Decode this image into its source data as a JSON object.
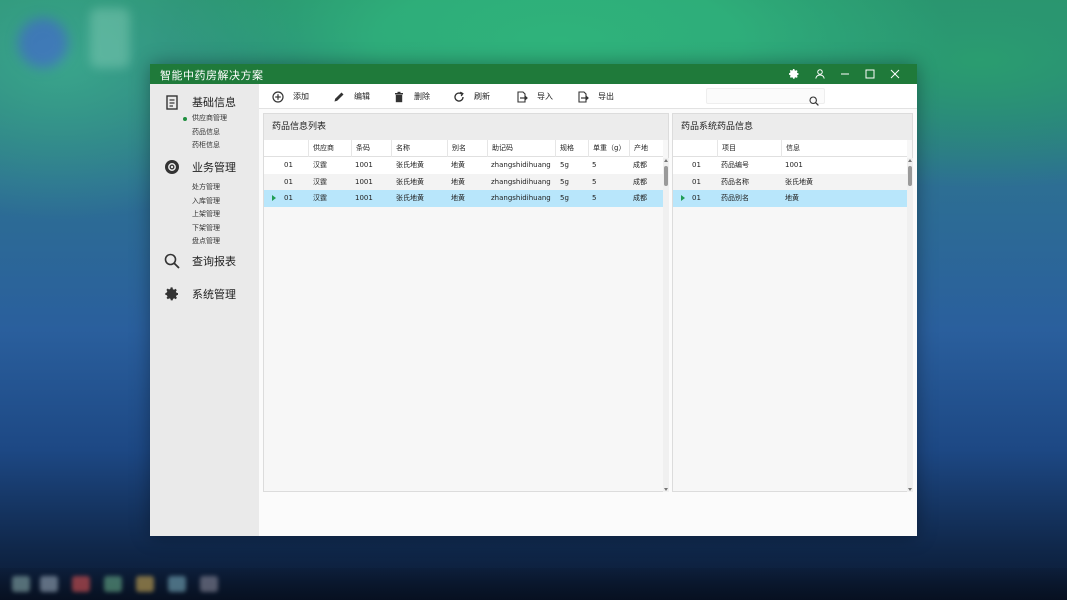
{
  "window": {
    "title": "智能中药房解决方案"
  },
  "colors": {
    "titlebar": "#1f7a3a",
    "selected_row": "#b8e6fb",
    "sidebar": "#eaeaea",
    "active_dot": "#1f8f3f"
  },
  "sidebar": {
    "groups": [
      {
        "label": "基础信息",
        "icon": "document-icon",
        "items": [
          "供应商管理",
          "药品信息",
          "药柜信息"
        ],
        "active_item": 0
      },
      {
        "label": "业务管理",
        "icon": "gear-circle-icon",
        "items": [
          "处方管理",
          "入库管理",
          "上架管理",
          "下架管理",
          "盘点管理"
        ]
      },
      {
        "label": "查询报表",
        "icon": "search-icon",
        "items": []
      },
      {
        "label": "系统管理",
        "icon": "cog-icon",
        "items": []
      }
    ]
  },
  "toolbar": {
    "buttons": [
      {
        "label": "添加",
        "icon": "add-circle-icon"
      },
      {
        "label": "编辑",
        "icon": "pencil-icon"
      },
      {
        "label": "删除",
        "icon": "trash-icon"
      },
      {
        "label": "刷新",
        "icon": "refresh-icon"
      },
      {
        "label": "导入",
        "icon": "import-icon"
      },
      {
        "label": "导出",
        "icon": "export-icon"
      }
    ],
    "search": {
      "value": "",
      "placeholder": ""
    }
  },
  "left_panel": {
    "title": "药品信息列表",
    "columns": [
      "",
      "供应商",
      "条码",
      "名称",
      "别名",
      "助记码",
      "规格",
      "单重（g）",
      "产地"
    ],
    "rows": [
      [
        "01",
        "汉霆",
        "1001",
        "张氏地黄",
        "地黄",
        "zhangshidihuang",
        "5g",
        "5",
        "成都"
      ],
      [
        "01",
        "汉霆",
        "1001",
        "张氏地黄",
        "地黄",
        "zhangshidihuang",
        "5g",
        "5",
        "成都"
      ],
      [
        "01",
        "汉霆",
        "1001",
        "张氏地黄",
        "地黄",
        "zhangshidihuang",
        "5g",
        "5",
        "成都"
      ]
    ],
    "selected_row": 2
  },
  "right_panel": {
    "title": "药品系统药品信息",
    "columns": [
      "",
      "项目",
      "信息"
    ],
    "rows": [
      [
        "01",
        "药品编号",
        "1001"
      ],
      [
        "01",
        "药品名称",
        "张氏地黄"
      ],
      [
        "01",
        "药品别名",
        "地黄"
      ]
    ],
    "selected_row": 2
  }
}
